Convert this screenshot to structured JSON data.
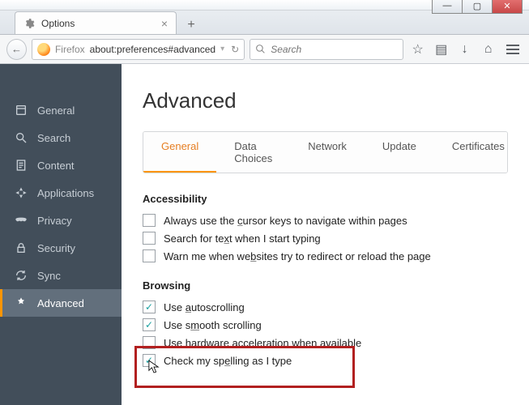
{
  "window": {
    "min": "—",
    "max": "▢",
    "close": "✕"
  },
  "tab": {
    "title": "Options",
    "close": "×",
    "new": "+"
  },
  "toolbar": {
    "back": "←",
    "fxlabel": "Firefox",
    "url": "about:preferences#advanced",
    "dropdown": "▾",
    "reload": "↻",
    "search_placeholder": "Search",
    "star": "☆",
    "clip": "▤",
    "down": "↓",
    "home": "⌂"
  },
  "sidebar": {
    "items": [
      {
        "label": "General"
      },
      {
        "label": "Search"
      },
      {
        "label": "Content"
      },
      {
        "label": "Applications"
      },
      {
        "label": "Privacy"
      },
      {
        "label": "Security"
      },
      {
        "label": "Sync"
      },
      {
        "label": "Advanced"
      }
    ]
  },
  "page": {
    "title": "Advanced",
    "tabs": [
      "General",
      "Data Choices",
      "Network",
      "Update",
      "Certificates"
    ],
    "section1": "Accessibility",
    "acc": [
      {
        "text_pre": "Always use the ",
        "u": "c",
        "text_post": "ursor keys to navigate within pages",
        "checked": false
      },
      {
        "text_pre": "Search for te",
        "u": "x",
        "text_post": "t when I start typing",
        "checked": false
      },
      {
        "text_pre": "Warn me when we",
        "u": "b",
        "text_post": "sites try to redirect or reload the page",
        "checked": false
      }
    ],
    "section2": "Browsing",
    "brw": [
      {
        "text_pre": "Use ",
        "u": "a",
        "text_post": "utoscrolling",
        "checked": true
      },
      {
        "text_pre": "Use s",
        "u": "m",
        "text_post": "ooth scrolling",
        "checked": true
      },
      {
        "text_pre": "Use hard",
        "u": "w",
        "text_post": "are acceleration when available",
        "checked": false
      },
      {
        "text_pre": "Check my sp",
        "u": "e",
        "text_post": "lling as I type",
        "checked": true
      }
    ]
  }
}
